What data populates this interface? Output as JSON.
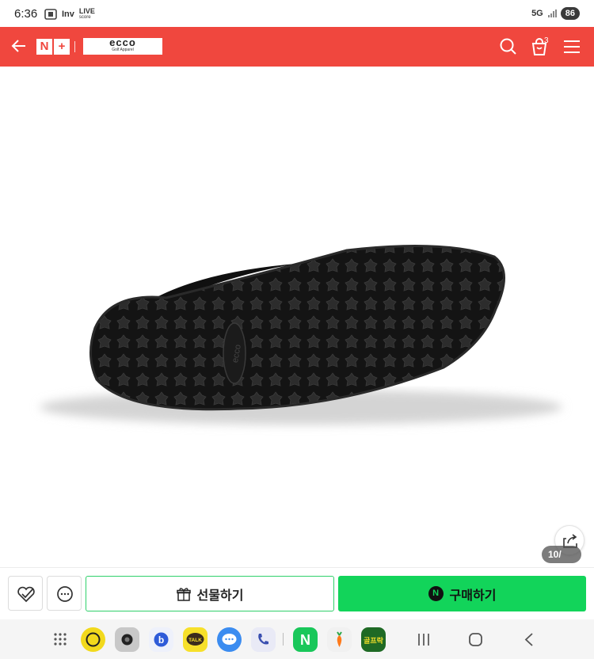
{
  "status_bar": {
    "time": "6:36",
    "inv_label": "Inv",
    "live_label": "LIVE",
    "score_label": "score",
    "network_label": "5G",
    "battery": "86"
  },
  "header": {
    "brand_name": "ecco",
    "brand_sub": "Golf Apparel",
    "cart_count": "3",
    "accent_color": "#f0473e"
  },
  "product": {
    "image_counter": "10/"
  },
  "actions": {
    "gift_label": "선물하기",
    "buy_label": "구매하기",
    "buy_icon_label": "N",
    "buy_color": "#12d45a"
  },
  "dock": {
    "apps": [
      "apps-grid-icon",
      "samsung-app-icon",
      "camera-icon",
      "bixby-icon",
      "kakaotalk-icon",
      "messages-icon",
      "phone-icon",
      "naver-icon",
      "carrot-icon",
      "golf-app-icon"
    ],
    "naver_label": "N",
    "kakao_label": "TALK",
    "golf_label": "골프락"
  }
}
